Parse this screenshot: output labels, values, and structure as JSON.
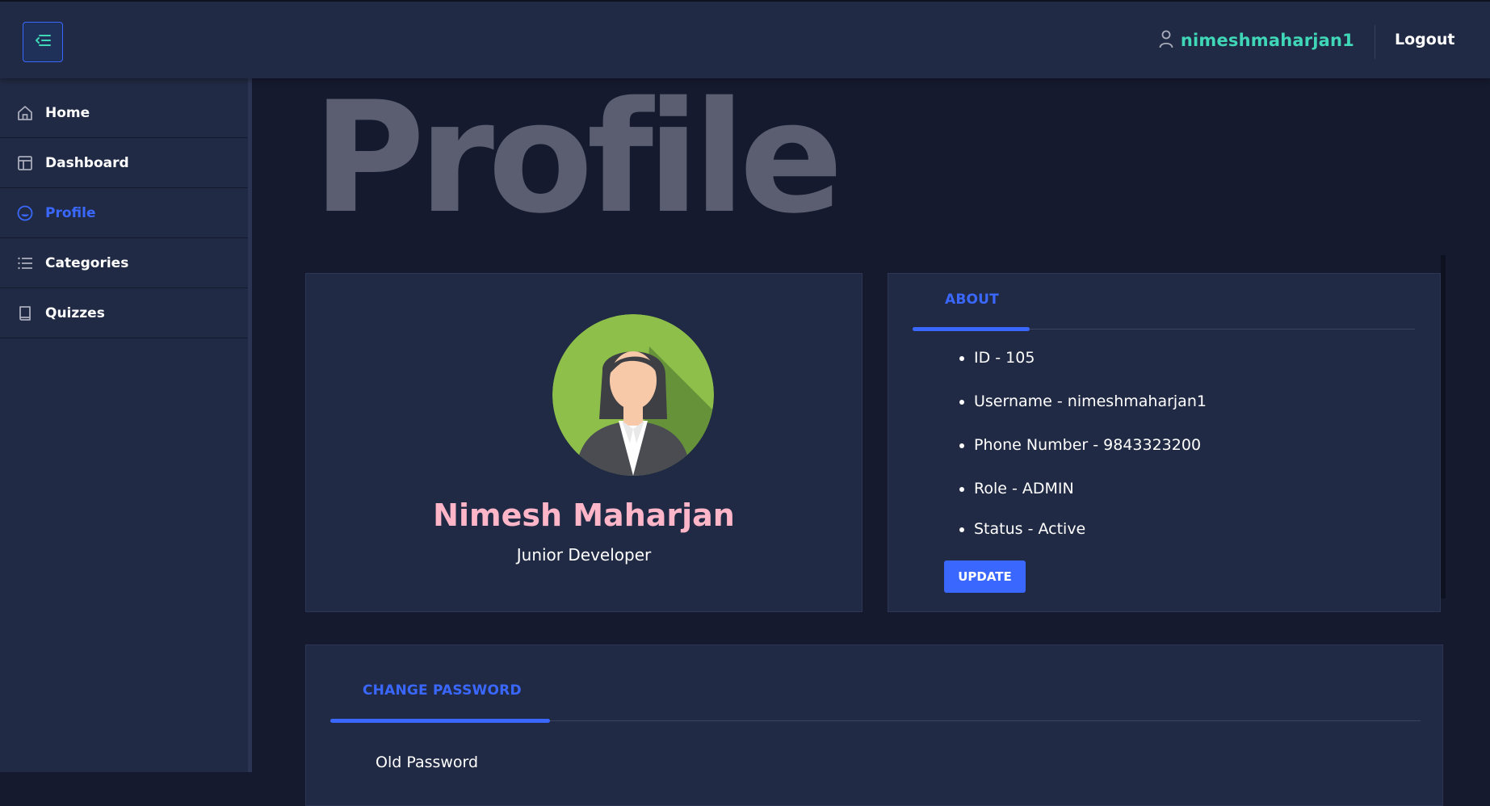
{
  "header": {
    "menu_toggle_icon": "menu-collapse-icon",
    "user_icon": "user-icon",
    "username": "nimeshmaharjan1",
    "logout_label": "Logout",
    "accent_color": "#3fd7b7"
  },
  "sidebar": {
    "items": [
      {
        "label": "Home",
        "icon": "home-icon"
      },
      {
        "label": "Dashboard",
        "icon": "dashboard-icon"
      },
      {
        "label": "Profile",
        "icon": "profile-icon",
        "active": true
      },
      {
        "label": "Categories",
        "icon": "list-icon"
      },
      {
        "label": "Quizzes",
        "icon": "book-icon"
      }
    ],
    "active_color": "#3a68ff"
  },
  "page": {
    "title": "Profile"
  },
  "profile_card": {
    "name": "Nimesh Maharjan",
    "role": "Junior Developer",
    "name_color": "#ffb6c9"
  },
  "about_card": {
    "tab_label": "ABOUT",
    "items": [
      "ID - 105",
      "Username - nimeshmaharjan1",
      "Phone Number - 9843323200",
      "Role - ADMIN",
      "Status - Active"
    ],
    "update_label": "UPDATE"
  },
  "password_card": {
    "tab_label": "CHANGE PASSWORD",
    "old_password_label": "Old Password"
  }
}
